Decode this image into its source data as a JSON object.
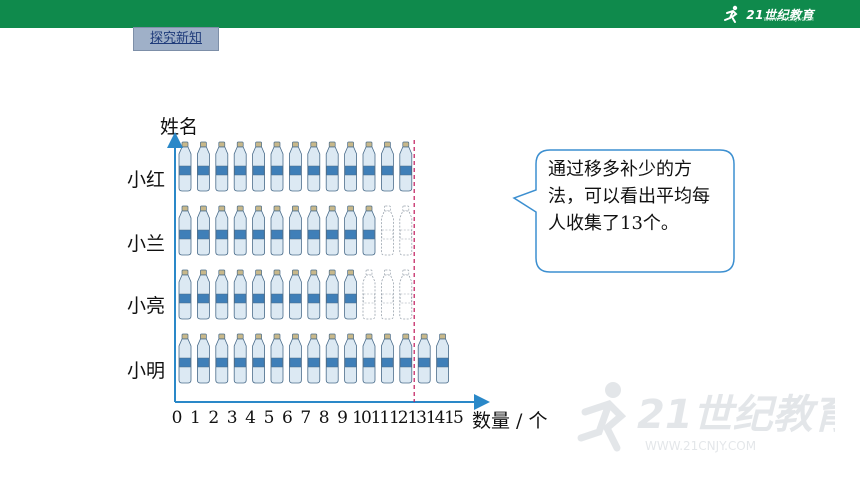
{
  "header": {
    "logo_text": "21世纪教育",
    "logo_sub": "WWW.21CNJY.COM",
    "bar_color": "#0f8a4c"
  },
  "section_tag": "探究新知",
  "callout": {
    "text": "通过移多补少的方法，可以看出平均每人收集了13个。"
  },
  "chart_data": {
    "type": "bar",
    "ylabel": "姓名",
    "xlabel": "数量 / 个",
    "categories": [
      "小红",
      "小兰",
      "小亮",
      "小明"
    ],
    "series": [
      {
        "values": [
          13,
          11,
          10,
          15
        ]
      },
      {
        "values": [
          0,
          2,
          3,
          0
        ]
      }
    ],
    "average": 13,
    "x_ticks": [
      "0",
      "1",
      "2",
      "3",
      "4",
      "5",
      "6",
      "7",
      "8",
      "9",
      "10",
      "11",
      "12",
      "13",
      "14",
      "15"
    ],
    "xlim": [
      0,
      15
    ],
    "bar_style": "bottle icons",
    "dashed_outline_bottles_mean": "moved in",
    "average_line_color": "#c0185a",
    "axis_color": "#2a88c8"
  }
}
